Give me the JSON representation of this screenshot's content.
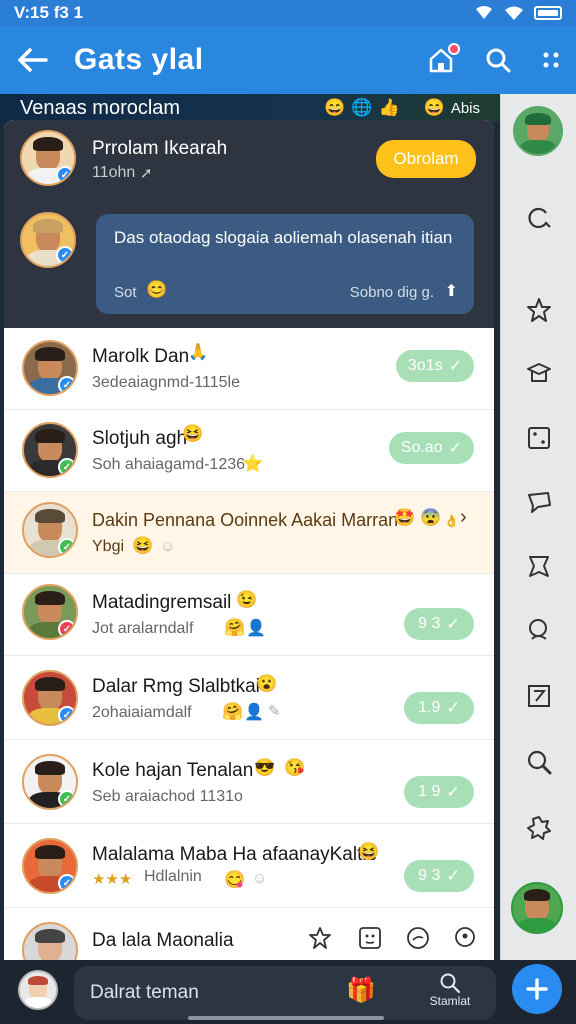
{
  "status": {
    "time": "V:15 f3 1"
  },
  "appbar": {
    "title": "Gats ylal"
  },
  "strip": {
    "title": "Venaas moroclam",
    "tag": "Abis"
  },
  "pinned": {
    "name": "Prrolam Ikearah",
    "meta": "11ohn",
    "button": "Obrolam",
    "bubble_text": "Das otaodag slogaia aoliemah olasenah itian",
    "bubble_left": "Sot",
    "bubble_right": "Sobno dig g."
  },
  "rows": [
    {
      "name": "Marolk Dan",
      "sub": "3edeaiagnmd-1115le",
      "pill": "3o1s",
      "verify_color": "#2a8cf0"
    },
    {
      "name": "Slotjuh agh",
      "sub": "Soh ahaiagamd-1236",
      "pill": "So.ao",
      "verify_color": "#3fbf4f"
    },
    {
      "name": "Dakin Pennana Ooinnek Aakai Marran",
      "sub": "Ybgi",
      "pill": "",
      "verify_color": "#3fbf4f"
    },
    {
      "name": "Matadingremsail",
      "sub": "Jot aralarndalf",
      "pill": "9 3",
      "verify_color": "#e8414f"
    },
    {
      "name": "Dalar Rmg Slalbtkai",
      "sub": "2ohaiaiamdalf",
      "pill": "1.9",
      "verify_color": "#2a8cf0"
    },
    {
      "name": "Kole hajan Tenalan",
      "sub": "Seb araiachod 1131o",
      "pill": "1 9",
      "verify_color": "#3fbf4f"
    },
    {
      "name": "Malalama Maba Ha afaanayKaltie",
      "sub": "Hdlalnin",
      "pill": "9 3",
      "verify_color": "#2a8cf0"
    },
    {
      "name": "Da lala Maonalia",
      "sub": "",
      "pill": "",
      "verify_color": ""
    }
  ],
  "bottom": {
    "placeholder": "Dalrat teman",
    "search_label": "Stamlat"
  },
  "colors": {
    "accent": "#2a87e0",
    "pill": "#a9dfb7",
    "pinned_button": "#ffc21a"
  }
}
